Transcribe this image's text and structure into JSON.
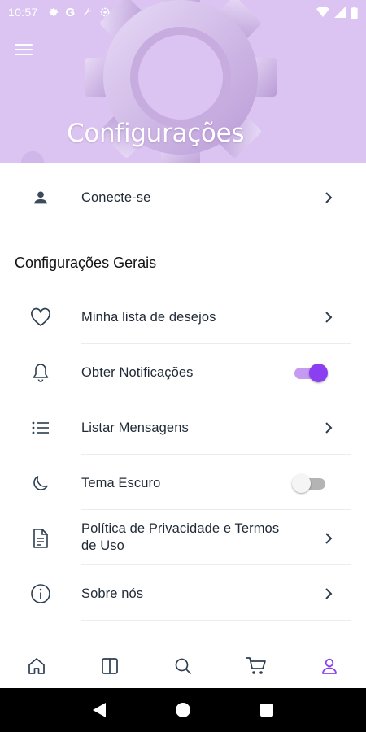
{
  "status_bar": {
    "time": "10:57",
    "left_icons": [
      "gear-icon",
      "google-icon",
      "wrench-icon",
      "settings-alt-icon"
    ],
    "right_icons": [
      "wifi-icon",
      "signal-icon",
      "battery-icon"
    ]
  },
  "header": {
    "title": "Configurações",
    "background_color": "#dcc4f2"
  },
  "account_row": {
    "label": "Conecte-se",
    "icon": "person-icon"
  },
  "general": {
    "section_title": "Configurações Gerais",
    "items": [
      {
        "label": "Minha lista de desejos",
        "icon": "heart-icon",
        "control": "chevron"
      },
      {
        "label": "Obter Notificações",
        "icon": "bell-icon",
        "control": "toggle",
        "enabled": true
      },
      {
        "label": "Listar Mensagens",
        "icon": "list-icon",
        "control": "chevron"
      },
      {
        "label": "Tema Escuro",
        "icon": "moon-icon",
        "control": "toggle",
        "enabled": false
      },
      {
        "label_line1": "Política de Privacidade e Termos",
        "label_line2": "de Uso",
        "icon": "document-icon",
        "control": "chevron"
      },
      {
        "label": "Sobre nós",
        "icon": "info-icon",
        "control": "chevron"
      }
    ]
  },
  "bottom_nav": {
    "items": [
      "home-icon",
      "catalog-icon",
      "search-icon",
      "cart-icon",
      "profile-icon"
    ],
    "active": "profile-icon",
    "active_color": "#8b3ff0",
    "inactive_color": "#2c3e50"
  },
  "colors": {
    "accent": "#8b3ff0",
    "text": "#1f2a36"
  }
}
